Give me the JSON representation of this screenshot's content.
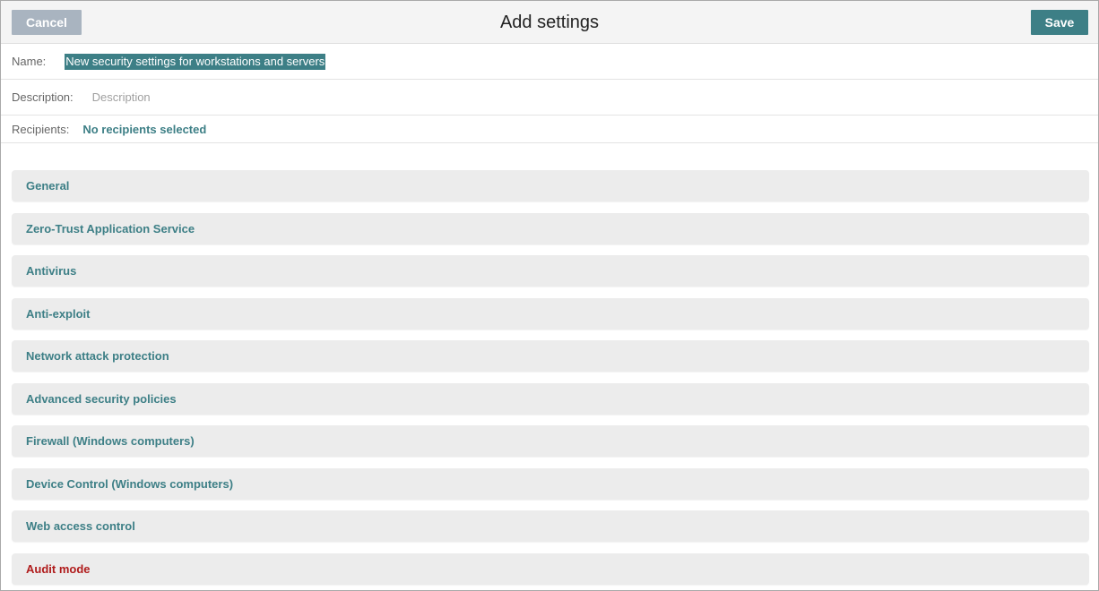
{
  "header": {
    "title": "Add settings",
    "cancel_label": "Cancel",
    "save_label": "Save"
  },
  "form": {
    "name_label": "Name:",
    "name_value": "New security settings for workstations and servers",
    "description_label": "Description:",
    "description_placeholder": "Description",
    "recipients_label": "Recipients:",
    "recipients_value": "No recipients selected"
  },
  "sections": [
    {
      "label": "General"
    },
    {
      "label": "Zero-Trust Application Service"
    },
    {
      "label": "Antivirus"
    },
    {
      "label": "Anti-exploit"
    },
    {
      "label": "Network attack protection"
    },
    {
      "label": "Advanced security policies"
    },
    {
      "label": "Firewall (Windows computers)"
    },
    {
      "label": "Device Control (Windows computers)"
    },
    {
      "label": "Web access control"
    },
    {
      "label": "Audit mode"
    }
  ],
  "colors": {
    "accent": "#3d7f86",
    "cancel": "#a9b4c0",
    "audit": "#b01c1c"
  }
}
